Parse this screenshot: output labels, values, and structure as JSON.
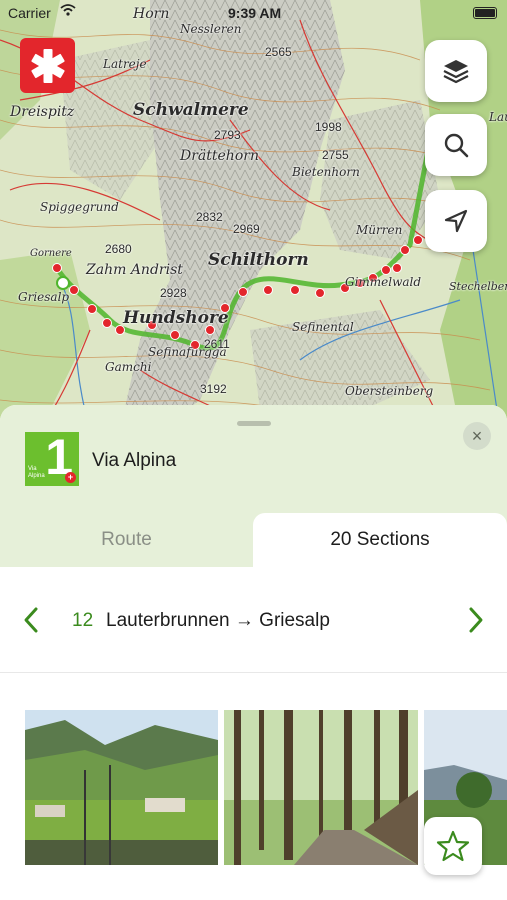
{
  "status_bar": {
    "carrier": "Carrier",
    "time": "9:39 AM"
  },
  "map": {
    "labels": {
      "horn": "Horn",
      "nessleren": "Nessleren",
      "e2565": "2565",
      "latreje": "Latreje",
      "schwalmere": "Schwalmere",
      "dreispitz": "Dreispitz",
      "e2793": "2793",
      "e1998": "1998",
      "e2755": "2755",
      "drattehorn": "Drättehorn",
      "bietenhorn": "Bietenhorn",
      "spiggegrund": "Spiggegrund",
      "e2832": "2832",
      "e2969": "2969",
      "murren": "Mürren",
      "e2680": "2680",
      "gornere": "Gornere",
      "zahm_andrist": "Zahm Andrist",
      "schilthorn": "Schilthorn",
      "gimmelwald": "Gimmelwald",
      "griesalp": "Griesalp",
      "e2928": "2928",
      "hundshore": "Hundshore",
      "sefinafurgga": "Sefinafurgga",
      "e2611": "2611",
      "sefinental": "Sefinental",
      "gamchi": "Gamchi",
      "e3192": "3192",
      "obersteinberg": "Obersteinberg",
      "stechelberg": "Stechelberg",
      "lau": "Lau"
    },
    "buttons": {
      "layers_icon": "layers-icon",
      "search_icon": "search-icon",
      "locate_icon": "location-arrow-icon"
    }
  },
  "sheet": {
    "route_name": "Via Alpina",
    "route_logo": {
      "number": "1",
      "caption_line1": "Via",
      "caption_line2": "Alpina"
    },
    "close_icon": "×",
    "tabs": [
      {
        "label": "Route",
        "active": false
      },
      {
        "label": "20 Sections",
        "active": true
      }
    ],
    "section": {
      "number": "12",
      "name": "Lauterbrunnen → Griesalp"
    },
    "photos": [
      "valley-photo",
      "forest-trail-photo",
      "mountain-photo"
    ],
    "favorite_icon": "star-icon"
  },
  "colors": {
    "accent_green": "#3b8b1e",
    "route_red": "#e3262c",
    "sheet_bg": "#e6f0d9",
    "logo_green": "#6cbf2e"
  }
}
